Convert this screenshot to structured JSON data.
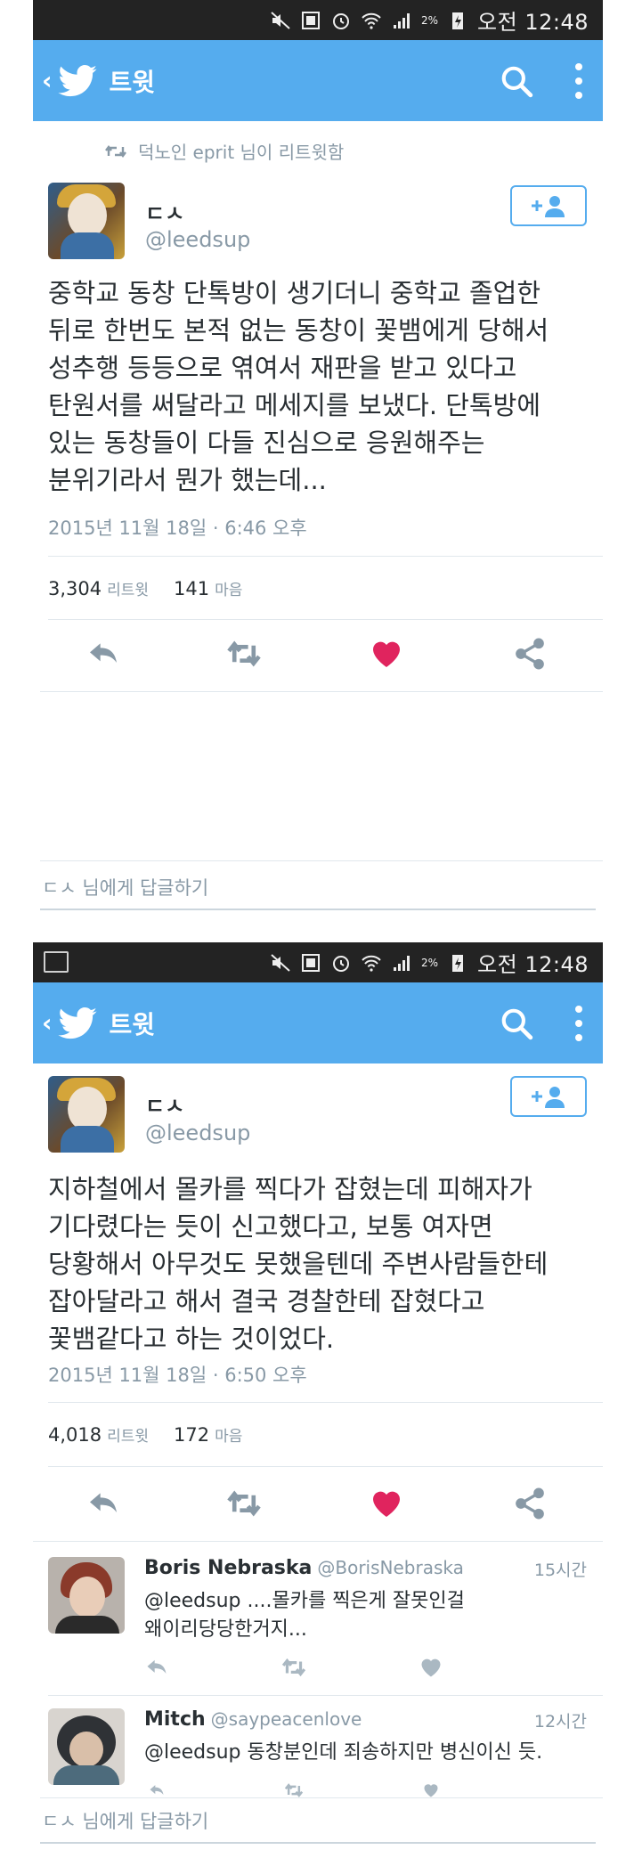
{
  "statusbar": {
    "battery": "2%",
    "time": "오전 12:48"
  },
  "appbar": {
    "back": "‹",
    "title": "트윗"
  },
  "colors": {
    "accent": "#55acee",
    "like": "#e0245e",
    "muted": "#8899a6"
  },
  "retweet_note": "덕노인 eprit 님이 리트윗함",
  "tweet1": {
    "name": "ㄷㅅ",
    "handle": "@leedsup",
    "text": "중학교 동창 단톡방이 생기더니 중학교 졸업한\n뒤로 한번도 본적 없는 동창이 꽃뱀에게 당해서\n성추행 등등으로 엮여서 재판을 받고 있다고\n탄원서를 써달라고 메세지를 보냈다. 단톡방에\n있는 동창들이 다들 진심으로 응원해주는\n분위기라서 뭔가 했는데...",
    "time": "2015년 11월 18일 · 6:46 오후",
    "retweets": "3,304",
    "retweets_label": "리트윗",
    "likes": "141",
    "likes_label": "마음"
  },
  "reply_placeholder": "ㄷㅅ 님에게 답글하기",
  "tweet2": {
    "name": "ㄷㅅ",
    "handle": "@leedsup",
    "text": "지하철에서 몰카를 찍다가 잡혔는데 피해자가\n기다렸다는 듯이 신고했다고, 보통 여자면\n당황해서 아무것도 못했을텐데 주변사람들한테\n잡아달라고 해서 결국 경찰한테 잡혔다고\n꽃뱀같다고 하는 것이었다.",
    "time": "2015년 11월 18일 · 6:50 오후",
    "retweets": "4,018",
    "retweets_label": "리트윗",
    "likes": "172",
    "likes_label": "마음"
  },
  "replies": [
    {
      "name": "Boris Nebraska",
      "handle": "@BorisNebraska",
      "time": "15시간",
      "text": "@leedsup ....몰카를 찍은게 잘못인걸\n왜이리당당한거지..."
    },
    {
      "name": "Mitch",
      "handle": "@saypeacenlove",
      "time": "12시간",
      "text": "@leedsup 동창분인데 죄송하지만 병신이신 듯."
    }
  ]
}
